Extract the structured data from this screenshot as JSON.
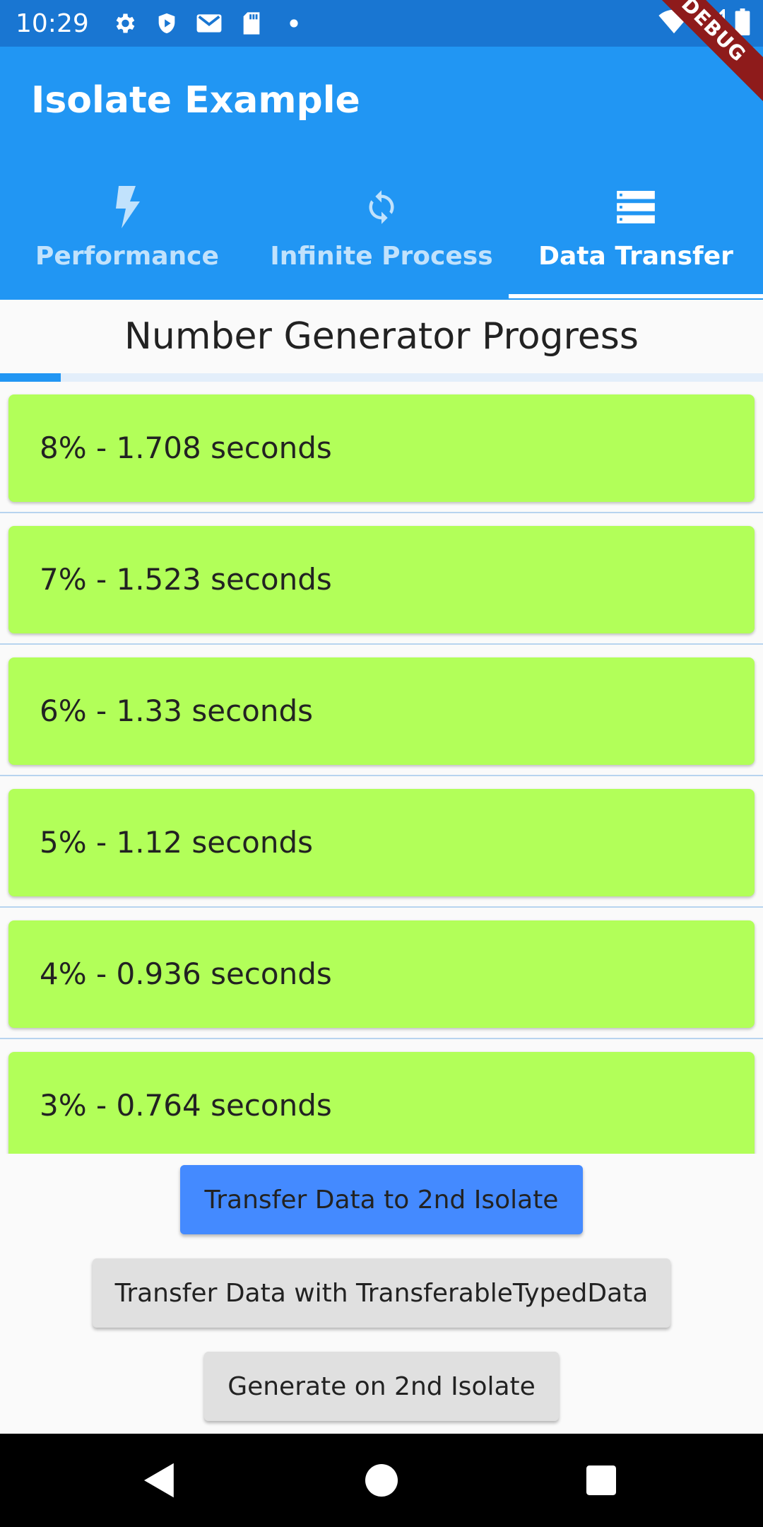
{
  "status_bar": {
    "time": "10:29",
    "icons": [
      "settings-icon",
      "shield-icon",
      "gmail-icon",
      "sd-card-icon",
      "dot-icon"
    ],
    "right_icons": [
      "wifi-icon",
      "signal-icon",
      "battery-icon"
    ]
  },
  "debug_banner": "DEBUG",
  "app_bar": {
    "title": "Isolate Example",
    "tabs": [
      {
        "label": "Performance",
        "icon": "flash-icon",
        "active": false
      },
      {
        "label": "Infinite Process",
        "icon": "sync-icon",
        "active": false
      },
      {
        "label": "Data Transfer",
        "icon": "storage-icon",
        "active": true
      }
    ]
  },
  "main": {
    "section_title": "Number Generator Progress",
    "progress": 0.08,
    "items": [
      {
        "text": "8% - 1.708 seconds"
      },
      {
        "text": "7% - 1.523 seconds"
      },
      {
        "text": "6% - 1.33 seconds"
      },
      {
        "text": "5% - 1.12 seconds"
      },
      {
        "text": "4% - 0.936 seconds"
      },
      {
        "text": "3% - 0.764 seconds"
      }
    ]
  },
  "actions": {
    "transfer_label": "Transfer Data to 2nd Isolate",
    "transferable_label": "Transfer Data with TransferableTypedData",
    "generate_label": "Generate on 2nd Isolate"
  },
  "colors": {
    "app_bar": "#2196f3",
    "status_bar": "#1976d2",
    "card": "#b2ff59",
    "primary_button": "#448aff",
    "secondary_button": "#e0e0e0"
  }
}
